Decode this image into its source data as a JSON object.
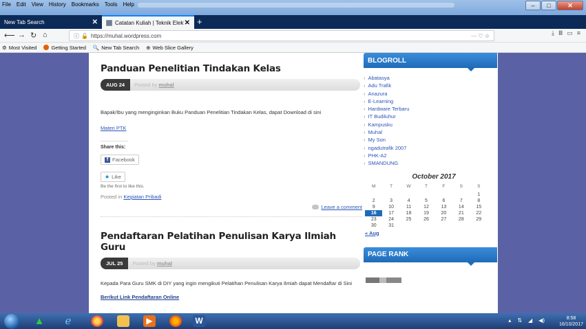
{
  "menu": [
    "File",
    "Edit",
    "View",
    "History",
    "Bookmarks",
    "Tools",
    "Help"
  ],
  "tabs": [
    {
      "label": "New Tab Search"
    },
    {
      "label": "Catatan Kuliah | Teknik Elektro"
    }
  ],
  "url": "https://muhal.wordpress.com",
  "bookmarks": [
    "Most Visited",
    "Getting Started",
    "New Tab Search",
    "Web Slice Gallery"
  ],
  "posts": [
    {
      "title": "Panduan Penelitian Tindakan Kelas",
      "date": "AUG 24",
      "posted_by_prefix": "Posted by",
      "author": "muhal",
      "body": "Bapak/Ibu yang menginginkan Buku Panduan Penelitian Tindakan Kelas, dapat Download di sini",
      "link": "Materi PTK",
      "share_title": "Share this:",
      "share_facebook": "Facebook",
      "like_label": "Like",
      "like_note": "Be the first to like this.",
      "posted_in_prefix": "Posted in",
      "category": "Kegiatan Pribadi",
      "comment_link": "Leave a comment"
    },
    {
      "title": "Pendaftaran Pelatihan Penulisan Karya Ilmiah Guru",
      "date": "JUL 25",
      "posted_by_prefix": "Posted by",
      "author": "muhal",
      "body": "Kepada Para Guru SMK di DIY yang ingin mengikuti Pelatihan Penulisan Karya Ilmiah dapat Mendaftar di Sini",
      "link": "Berikut Link Pendaftaran Online"
    }
  ],
  "sidebar": {
    "blogroll_title": "BLOGROLL",
    "blogroll": [
      "Abatasya",
      "Adu Trafik",
      "Anazura",
      "E-Learning",
      "Hardware Terbaru",
      "IT Budiluhur",
      "Kampusku",
      "Muhal",
      "My Son",
      "ngadutrafik 2007",
      "PHK-A2",
      "SMANDUNG"
    ],
    "calendar": {
      "title": "October 2017",
      "days": [
        "M",
        "T",
        "W",
        "T",
        "F",
        "S",
        "S"
      ],
      "weeks": [
        [
          "",
          "",
          "",
          "",
          "",
          "",
          "1"
        ],
        [
          "2",
          "3",
          "4",
          "5",
          "6",
          "7",
          "8"
        ],
        [
          "9",
          "10",
          "11",
          "12",
          "13",
          "14",
          "15"
        ],
        [
          "16",
          "17",
          "18",
          "19",
          "20",
          "21",
          "22"
        ],
        [
          "23",
          "24",
          "25",
          "26",
          "27",
          "28",
          "29"
        ],
        [
          "30",
          "31",
          "",
          "",
          "",
          "",
          ""
        ]
      ],
      "today": "16",
      "prev": "« Aug"
    },
    "pagerank_title": "PAGE RANK"
  },
  "clock": {
    "time": "8:58",
    "date": "16/10/2017"
  }
}
